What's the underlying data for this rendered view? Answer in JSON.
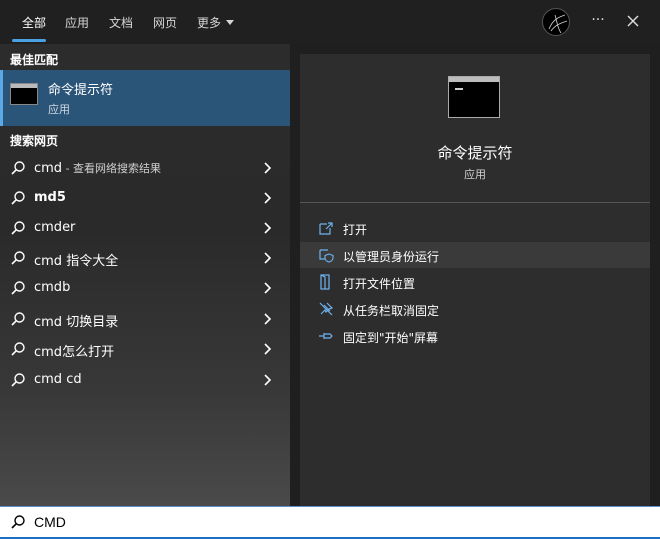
{
  "tabs": [
    {
      "label": "全部",
      "active": true
    },
    {
      "label": "应用"
    },
    {
      "label": "文档"
    },
    {
      "label": "网页"
    },
    {
      "label": "更多"
    }
  ],
  "more_button": "···",
  "best_match": {
    "section": "最佳匹配",
    "title": "命令提示符",
    "subtitle": "应用"
  },
  "web": {
    "section": "搜索网页",
    "items": [
      {
        "text": "cmd",
        "hint": " - 查看网络搜索结果"
      },
      {
        "text": "md5"
      },
      {
        "text": "cmder"
      },
      {
        "text": "cmd 指令大全"
      },
      {
        "text": "cmdb"
      },
      {
        "text": "cmd 切换目录"
      },
      {
        "text": "cmd怎么打开"
      },
      {
        "text": "cmd cd"
      }
    ]
  },
  "preview": {
    "title": "命令提示符",
    "subtitle": "应用",
    "actions": [
      {
        "label": "打开",
        "icon": "open-icon"
      },
      {
        "label": "以管理员身份运行",
        "icon": "shield-icon"
      },
      {
        "label": "打开文件位置",
        "icon": "file-location-icon"
      },
      {
        "label": "从任务栏取消固定",
        "icon": "unpin-icon"
      },
      {
        "label": "固定到\"开始\"屏幕",
        "icon": "pin-icon"
      }
    ]
  },
  "search": {
    "value": "CMD"
  },
  "colors": {
    "accent": "#4aa0e0",
    "selected": "#2b5479"
  }
}
